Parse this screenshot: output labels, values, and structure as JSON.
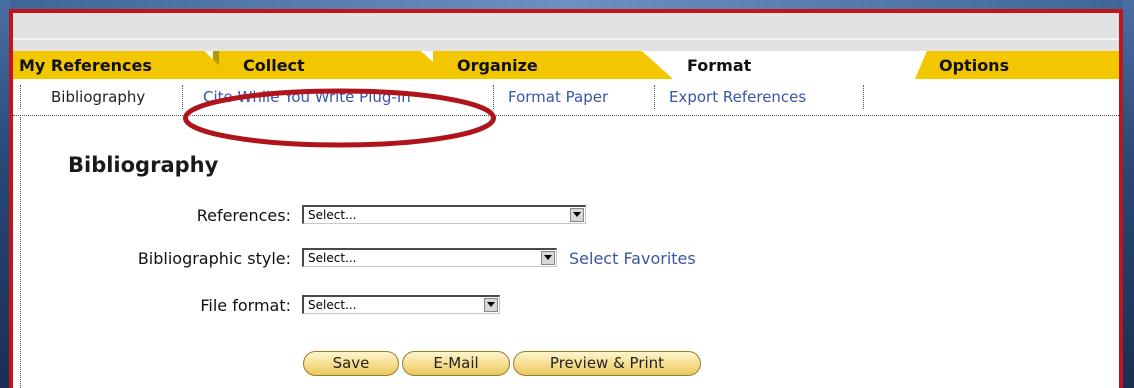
{
  "tabs": [
    {
      "label": "My References",
      "state": "inactive"
    },
    {
      "label": "Collect",
      "state": "inactive"
    },
    {
      "label": "Organize",
      "state": "inactive"
    },
    {
      "label": "Format",
      "state": "active"
    },
    {
      "label": "Options",
      "state": "inactive"
    }
  ],
  "subnav": [
    {
      "label": "Bibliography",
      "current": true
    },
    {
      "label": "Cite While You Write Plug-In",
      "current": false
    },
    {
      "label": "Format Paper",
      "current": false
    },
    {
      "label": "Export References",
      "current": false
    }
  ],
  "panel": {
    "title": "Bibliography",
    "fields": [
      {
        "label": "References:",
        "value": "Select..."
      },
      {
        "label": "Bibliographic style:",
        "value": "Select...",
        "link": "Select Favorites"
      },
      {
        "label": "File format:",
        "value": "Select..."
      }
    ],
    "buttons": [
      {
        "label": "Save"
      },
      {
        "label": "E-Mail"
      },
      {
        "label": "Preview & Print"
      }
    ]
  },
  "annotation": {
    "shape": "ellipse",
    "color": "#b0141b",
    "target": "Cite While You Write Plug-In"
  },
  "colors": {
    "tab_yellow": "#f2c700",
    "link": "#3a55a8",
    "frame_red": "#c0151b",
    "background_blue": "#1f3a5f"
  },
  "icons": {
    "dropdown": "chevron-down-icon"
  }
}
